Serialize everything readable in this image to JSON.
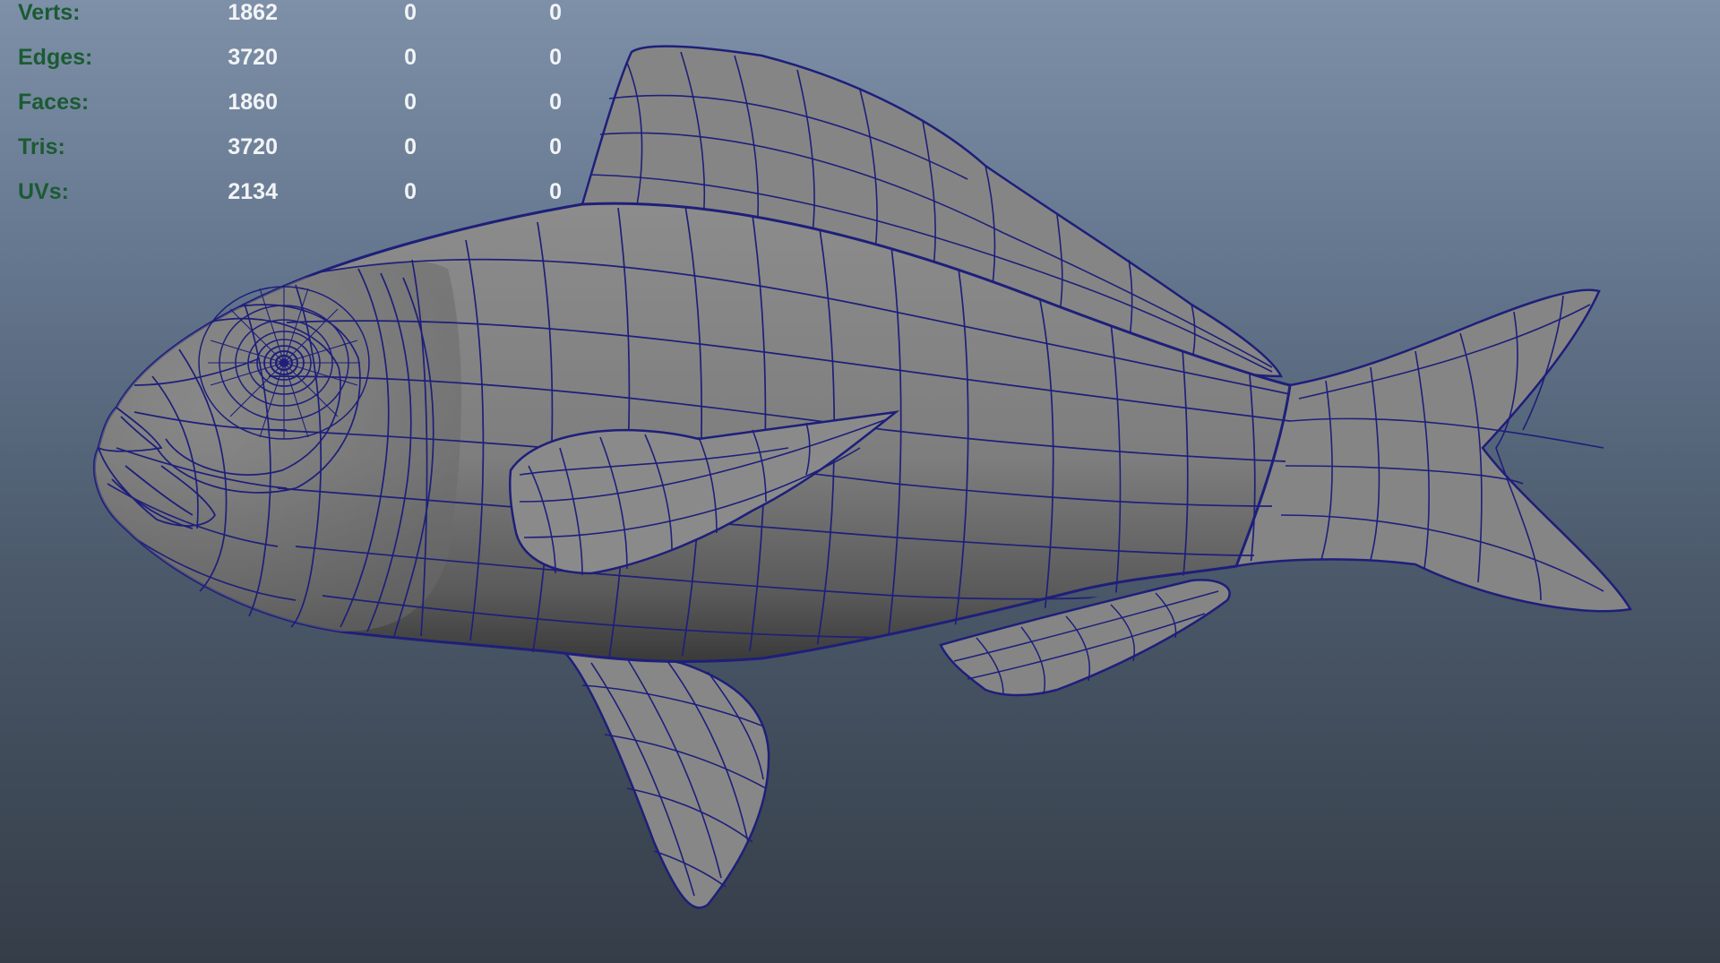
{
  "viewport": {
    "object": "fish-mesh",
    "wire_color": "#1e1f7a",
    "surface_color": "#8a8a8a",
    "background_top": "#7d90a8",
    "background_bottom": "#353d48"
  },
  "heads_up_display": {
    "rows": [
      {
        "label": "Verts:",
        "values": [
          "1862",
          "0",
          "0"
        ]
      },
      {
        "label": "Edges:",
        "values": [
          "3720",
          "0",
          "0"
        ]
      },
      {
        "label": "Faces:",
        "values": [
          "1860",
          "0",
          "0"
        ]
      },
      {
        "label": "Tris:",
        "values": [
          "3720",
          "0",
          "0"
        ]
      },
      {
        "label": "UVs:",
        "values": [
          "2134",
          "0",
          "0"
        ]
      }
    ]
  }
}
